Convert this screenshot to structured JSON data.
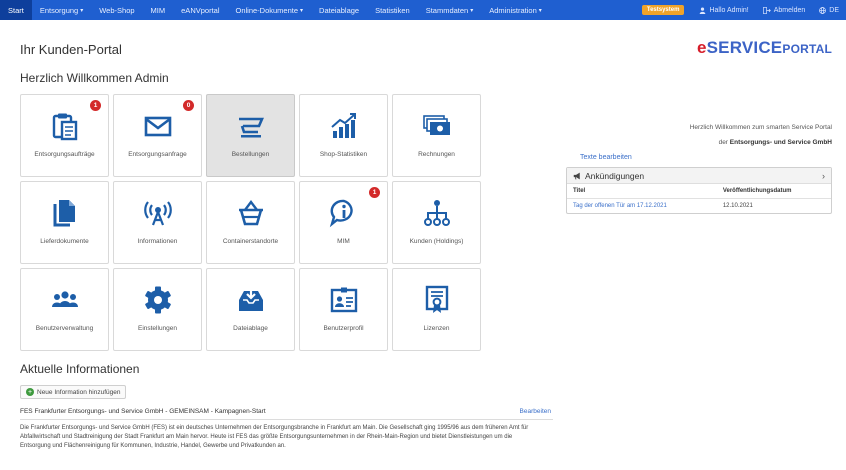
{
  "nav": {
    "items": [
      {
        "label": "Start",
        "active": true
      },
      {
        "label": "Entsorgung",
        "dropdown": true
      },
      {
        "label": "Web-Shop"
      },
      {
        "label": "MIM"
      },
      {
        "label": "eANVportal"
      },
      {
        "label": "Online-Dokumente",
        "dropdown": true
      },
      {
        "label": "Dateiablage"
      },
      {
        "label": "Statistiken"
      },
      {
        "label": "Stammdaten",
        "dropdown": true
      },
      {
        "label": "Administration",
        "dropdown": true
      }
    ],
    "test_badge": "Testsystem",
    "user_greeting": "Hallo Admin!",
    "logout": "Abmelden",
    "language": "DE"
  },
  "header": {
    "page_title": "Ihr Kunden-Portal",
    "logo_e": "e",
    "logo_service": "SERVICE",
    "logo_portal": "PORTAL",
    "welcome": "Herzlich Willkommen Admin"
  },
  "tiles": [
    {
      "label": "Entsorgungsaufträge",
      "icon": "clipboard-document-icon",
      "badge": "1"
    },
    {
      "label": "Entsorgungsanfrage",
      "icon": "envelope-icon",
      "badge": "0"
    },
    {
      "label": "Bestellungen",
      "icon": "shopping-cart-icon",
      "selected": true
    },
    {
      "label": "Shop-Statistiken",
      "icon": "bar-chart-trend-icon"
    },
    {
      "label": "Rechnungen",
      "icon": "money-bills-icon"
    },
    {
      "label": "Lieferdokumente",
      "icon": "documents-icon"
    },
    {
      "label": "Informationen",
      "icon": "broadcast-antenna-icon"
    },
    {
      "label": "Containerstandorte",
      "icon": "container-basket-icon"
    },
    {
      "label": "MIM",
      "icon": "info-speech-bubble-icon",
      "badge": "1"
    },
    {
      "label": "Kunden (Holdings)",
      "icon": "hierarchy-network-icon"
    },
    {
      "label": "Benutzerverwaltung",
      "icon": "users-group-icon"
    },
    {
      "label": "Einstellungen",
      "icon": "gear-icon"
    },
    {
      "label": "Dateiablage",
      "icon": "download-tray-icon"
    },
    {
      "label": "Benutzerprofil",
      "icon": "id-card-icon"
    },
    {
      "label": "Lizenzen",
      "icon": "certificate-icon"
    }
  ],
  "right": {
    "greeting_line1": "Herzlich Willkommen zum smarten Service Portal",
    "greeting_line2_prefix": "der ",
    "greeting_line2_company": "Entsorgungs- und Service GmbH",
    "edit_texts": "Texte bearbeiten",
    "announcements": {
      "title": "Ankündigungen",
      "columns": [
        "Titel",
        "Veröffentlichungsdatum"
      ],
      "rows": [
        {
          "title": "Tag der offenen Tür am 17.12.2021",
          "date": "12.10.2021"
        }
      ]
    }
  },
  "info": {
    "title": "Aktuelle Informationen",
    "add_button": "Neue Information hinzufügen",
    "news_title": "FES Frankfurter Entsorgungs- und Service GmbH - GEMEINSAM - Kampagnen-Start",
    "news_edit": "Bearbeiten",
    "news_body": "Die Frankfurter Entsorgungs- und Service GmbH (FES) ist ein deutsches Unternehmen der Entsorgungsbranche in Frankfurt am Main. Die Gesellschaft ging 1995/96 aus dem früheren Amt für Abfallwirtschaft und Stadtreinigung der Stadt Frankfurt am Main hervor. Heute ist FES das größte Entsorgungsunternehmen in der Rhein-Main-Region und bietet Dienstleistungen um die Entsorgung und Flächenreinigung für Kommunen, Industrie, Handel, Gewerbe und Privatkunden an."
  },
  "colors": {
    "nav_bg": "#1f5fd0",
    "icon": "#1d5ea8",
    "badge": "#d32a2a",
    "logo_blue": "#3c63c6",
    "logo_red": "#d61e2b",
    "test_badge": "#f0a32a"
  }
}
